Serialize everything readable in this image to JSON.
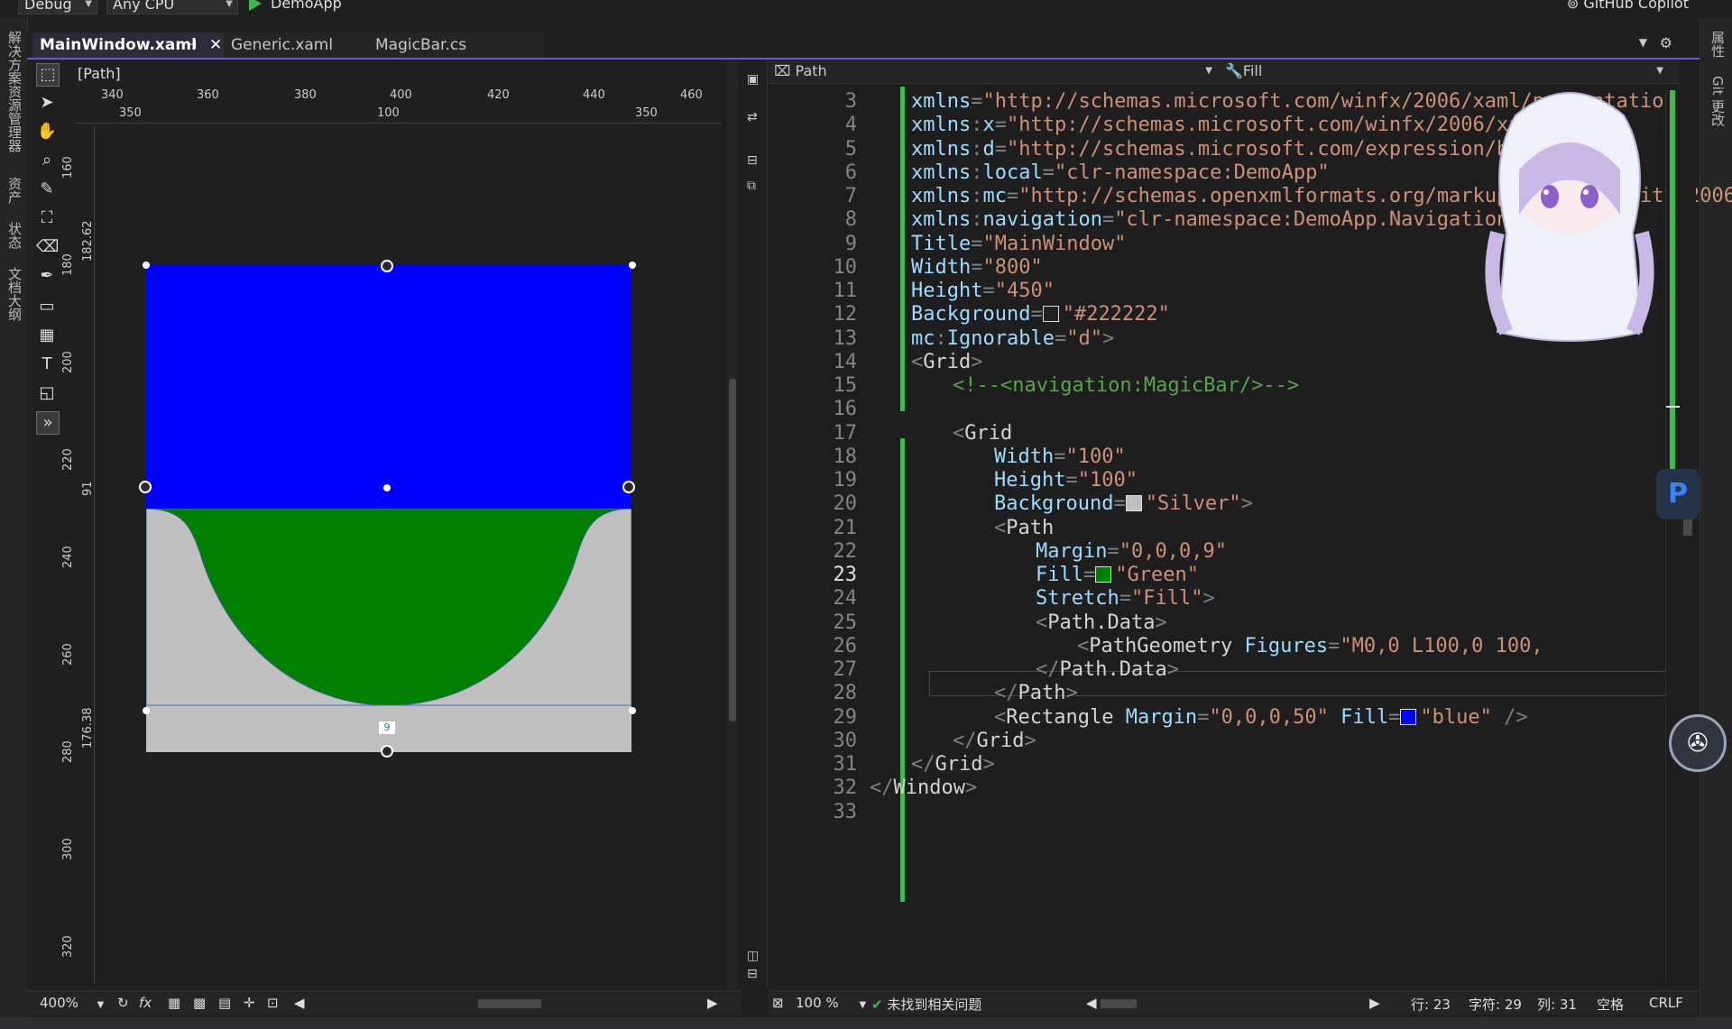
{
  "toolbar": {
    "config": "Debug",
    "platform": "Any CPU",
    "run_target": "DemoApp",
    "copilot": "GitHub Copilot"
  },
  "left_strip": [
    "解决方案资源管理器",
    "资产",
    "状态",
    "文档大纲"
  ],
  "right_strip": [
    "属性",
    "Git 更改"
  ],
  "tabs": [
    {
      "label": "MainWindow.xaml",
      "active": true
    },
    {
      "label": "Generic.xaml",
      "active": false
    },
    {
      "label": "MagicBar.cs",
      "active": false
    }
  ],
  "designer": {
    "breadcrumb": "[Path]",
    "ruler_top_row1": [
      "340",
      "360",
      "380",
      "400",
      "420",
      "440",
      "460"
    ],
    "ruler_top_row2": [
      "350",
      "100",
      "350"
    ],
    "ruler_left": [
      "160",
      "180",
      "200",
      "220",
      "240",
      "260",
      "280",
      "300",
      "320"
    ],
    "dim_labels": [
      "182.62",
      "91",
      "176.38"
    ],
    "margin_label": "9",
    "colors": {
      "blue": "#0000ff",
      "green": "#008000",
      "silver": "#c0c0c0"
    }
  },
  "editor": {
    "element_selector": "Path",
    "property_selector": "Fill",
    "lines": [
      {
        "n": "3",
        "indent": 2,
        "parts": [
          [
            "a",
            "xmlns"
          ],
          [
            "p",
            "="
          ],
          [
            "s",
            "\"http://schemas.microsoft.com/winfx/2006/xaml/presentation\""
          ]
        ]
      },
      {
        "n": "4",
        "indent": 2,
        "parts": [
          [
            "a",
            "xmlns"
          ],
          [
            "p",
            ":"
          ],
          [
            "a",
            "x"
          ],
          [
            "p",
            "="
          ],
          [
            "s",
            "\"http://schemas.microsoft.com/winfx/2006/xaml\""
          ]
        ]
      },
      {
        "n": "5",
        "indent": 2,
        "parts": [
          [
            "a",
            "xmlns"
          ],
          [
            "p",
            ":"
          ],
          [
            "a",
            "d"
          ],
          [
            "p",
            "="
          ],
          [
            "s",
            "\"http://schemas.microsoft.com/expression/blend/2008\""
          ]
        ]
      },
      {
        "n": "6",
        "indent": 2,
        "parts": [
          [
            "a",
            "xmlns"
          ],
          [
            "p",
            ":"
          ],
          [
            "a",
            "local"
          ],
          [
            "p",
            "="
          ],
          [
            "s",
            "\"clr-namespace:DemoApp\""
          ]
        ]
      },
      {
        "n": "7",
        "indent": 2,
        "parts": [
          [
            "a",
            "xmlns"
          ],
          [
            "p",
            ":"
          ],
          [
            "a",
            "mc"
          ],
          [
            "p",
            "="
          ],
          [
            "s",
            "\"http://schemas.openxmlformats.org/markup-compatibility/2006\""
          ]
        ]
      },
      {
        "n": "8",
        "indent": 2,
        "parts": [
          [
            "a",
            "xmlns"
          ],
          [
            "p",
            ":"
          ],
          [
            "a",
            "navigation"
          ],
          [
            "p",
            "="
          ],
          [
            "s",
            "\"clr-namespace:DemoApp.Navigation\""
          ]
        ]
      },
      {
        "n": "9",
        "indent": 2,
        "parts": [
          [
            "a",
            "Title"
          ],
          [
            "p",
            "="
          ],
          [
            "s",
            "\"MainWindow\""
          ]
        ]
      },
      {
        "n": "10",
        "indent": 2,
        "parts": [
          [
            "a",
            "Width"
          ],
          [
            "p",
            "="
          ],
          [
            "s",
            "\"800\""
          ]
        ]
      },
      {
        "n": "11",
        "indent": 2,
        "parts": [
          [
            "a",
            "Height"
          ],
          [
            "p",
            "="
          ],
          [
            "s",
            "\"450\""
          ]
        ]
      },
      {
        "n": "12",
        "indent": 2,
        "parts": [
          [
            "a",
            "Background"
          ],
          [
            "p",
            "="
          ],
          [
            "sw",
            "#222222"
          ],
          [
            "s",
            "\"#222222\""
          ]
        ]
      },
      {
        "n": "13",
        "indent": 2,
        "parts": [
          [
            "a",
            "mc"
          ],
          [
            "p",
            ":"
          ],
          [
            "a",
            "Ignorable"
          ],
          [
            "p",
            "="
          ],
          [
            "s",
            "\"d\""
          ],
          [
            "p",
            ">"
          ]
        ]
      },
      {
        "n": "14",
        "indent": 2,
        "parts": [
          [
            "p",
            "<"
          ],
          [
            "t",
            "Grid"
          ],
          [
            "p",
            ">"
          ]
        ]
      },
      {
        "n": "15",
        "indent": 3,
        "parts": [
          [
            "c",
            "<!--<navigation:MagicBar/>-->"
          ]
        ]
      },
      {
        "n": "16",
        "indent": 3,
        "parts": []
      },
      {
        "n": "17",
        "indent": 3,
        "parts": [
          [
            "p",
            "<"
          ],
          [
            "t",
            "Grid"
          ]
        ]
      },
      {
        "n": "18",
        "indent": 4,
        "parts": [
          [
            "a",
            "Width"
          ],
          [
            "p",
            "="
          ],
          [
            "s",
            "\"100\""
          ]
        ]
      },
      {
        "n": "19",
        "indent": 4,
        "parts": [
          [
            "a",
            "Height"
          ],
          [
            "p",
            "="
          ],
          [
            "s",
            "\"100\""
          ]
        ]
      },
      {
        "n": "20",
        "indent": 4,
        "parts": [
          [
            "a",
            "Background"
          ],
          [
            "p",
            "="
          ],
          [
            "sw",
            "#c0c0c0"
          ],
          [
            "s",
            "\"Silver\""
          ],
          [
            "p",
            ">"
          ]
        ]
      },
      {
        "n": "21",
        "indent": 4,
        "parts": [
          [
            "p",
            "<"
          ],
          [
            "t",
            "Path"
          ]
        ]
      },
      {
        "n": "22",
        "indent": 5,
        "parts": [
          [
            "a",
            "Margin"
          ],
          [
            "p",
            "="
          ],
          [
            "s",
            "\"0,0,0,9\""
          ]
        ]
      },
      {
        "n": "23",
        "indent": 5,
        "parts": [
          [
            "a",
            "Fill"
          ],
          [
            "p",
            "="
          ],
          [
            "sw",
            "#008000"
          ],
          [
            "s",
            "\"Green\""
          ]
        ]
      },
      {
        "n": "24",
        "indent": 5,
        "parts": [
          [
            "a",
            "Stretch"
          ],
          [
            "p",
            "="
          ],
          [
            "s",
            "\"Fill\""
          ],
          [
            "p",
            ">"
          ]
        ]
      },
      {
        "n": "25",
        "indent": 5,
        "parts": [
          [
            "p",
            "<"
          ],
          [
            "t",
            "Path.Data"
          ],
          [
            "p",
            ">"
          ]
        ]
      },
      {
        "n": "26",
        "indent": 6,
        "parts": [
          [
            "p",
            "<"
          ],
          [
            "t",
            "PathGeometry "
          ],
          [
            "a",
            "Figures"
          ],
          [
            "p",
            "="
          ],
          [
            "s",
            "\"M0,0 L100,0 100,"
          ]
        ]
      },
      {
        "n": "27",
        "indent": 5,
        "parts": [
          [
            "p",
            "</"
          ],
          [
            "t",
            "Path.Data"
          ],
          [
            "p",
            ">"
          ]
        ]
      },
      {
        "n": "28",
        "indent": 4,
        "parts": [
          [
            "p",
            "</"
          ],
          [
            "t",
            "Path"
          ],
          [
            "p",
            ">"
          ]
        ]
      },
      {
        "n": "29",
        "indent": 4,
        "parts": [
          [
            "p",
            "<"
          ],
          [
            "t",
            "Rectangle "
          ],
          [
            "a",
            "Margin"
          ],
          [
            "p",
            "="
          ],
          [
            "s",
            "\"0,0,0,50\""
          ],
          [
            "t",
            " "
          ],
          [
            "a",
            "Fill"
          ],
          [
            "p",
            "="
          ],
          [
            "sw",
            "#0000ff"
          ],
          [
            "s",
            "\"blue\""
          ],
          [
            "t",
            " "
          ],
          [
            "p",
            "/>"
          ]
        ]
      },
      {
        "n": "30",
        "indent": 3,
        "parts": [
          [
            "p",
            "</"
          ],
          [
            "t",
            "Grid"
          ],
          [
            "p",
            ">"
          ]
        ]
      },
      {
        "n": "31",
        "indent": 2,
        "parts": [
          [
            "p",
            "</"
          ],
          [
            "t",
            "Grid"
          ],
          [
            "p",
            ">"
          ]
        ]
      },
      {
        "n": "32",
        "indent": 1,
        "parts": [
          [
            "p",
            "</"
          ],
          [
            "t",
            "Window"
          ],
          [
            "p",
            ">"
          ]
        ]
      },
      {
        "n": "33",
        "indent": 1,
        "parts": []
      }
    ],
    "current_line": "23"
  },
  "designer_status": {
    "zoom": "400%"
  },
  "editor_status": {
    "zoom": "100 %",
    "issues": "未找到相关问题",
    "row": "行: 23",
    "char": "字符: 29",
    "col": "列: 31",
    "whitespace": "空格",
    "eol": "CRLF"
  },
  "badge_letter": "P"
}
